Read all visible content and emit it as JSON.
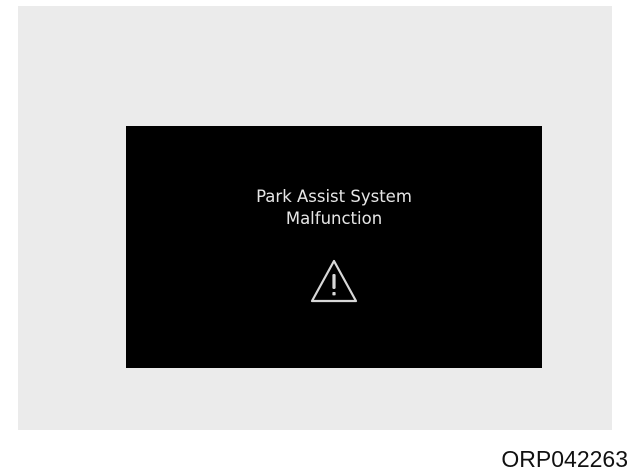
{
  "display": {
    "message_line1": "Park Assist System",
    "message_line2": "Malfunction",
    "icon": "warning-triangle-icon",
    "background_color": "#000000",
    "text_color": "#e6e6e6"
  },
  "page": {
    "background_color": "#ebebeb"
  },
  "figure_code": "ORP042263"
}
